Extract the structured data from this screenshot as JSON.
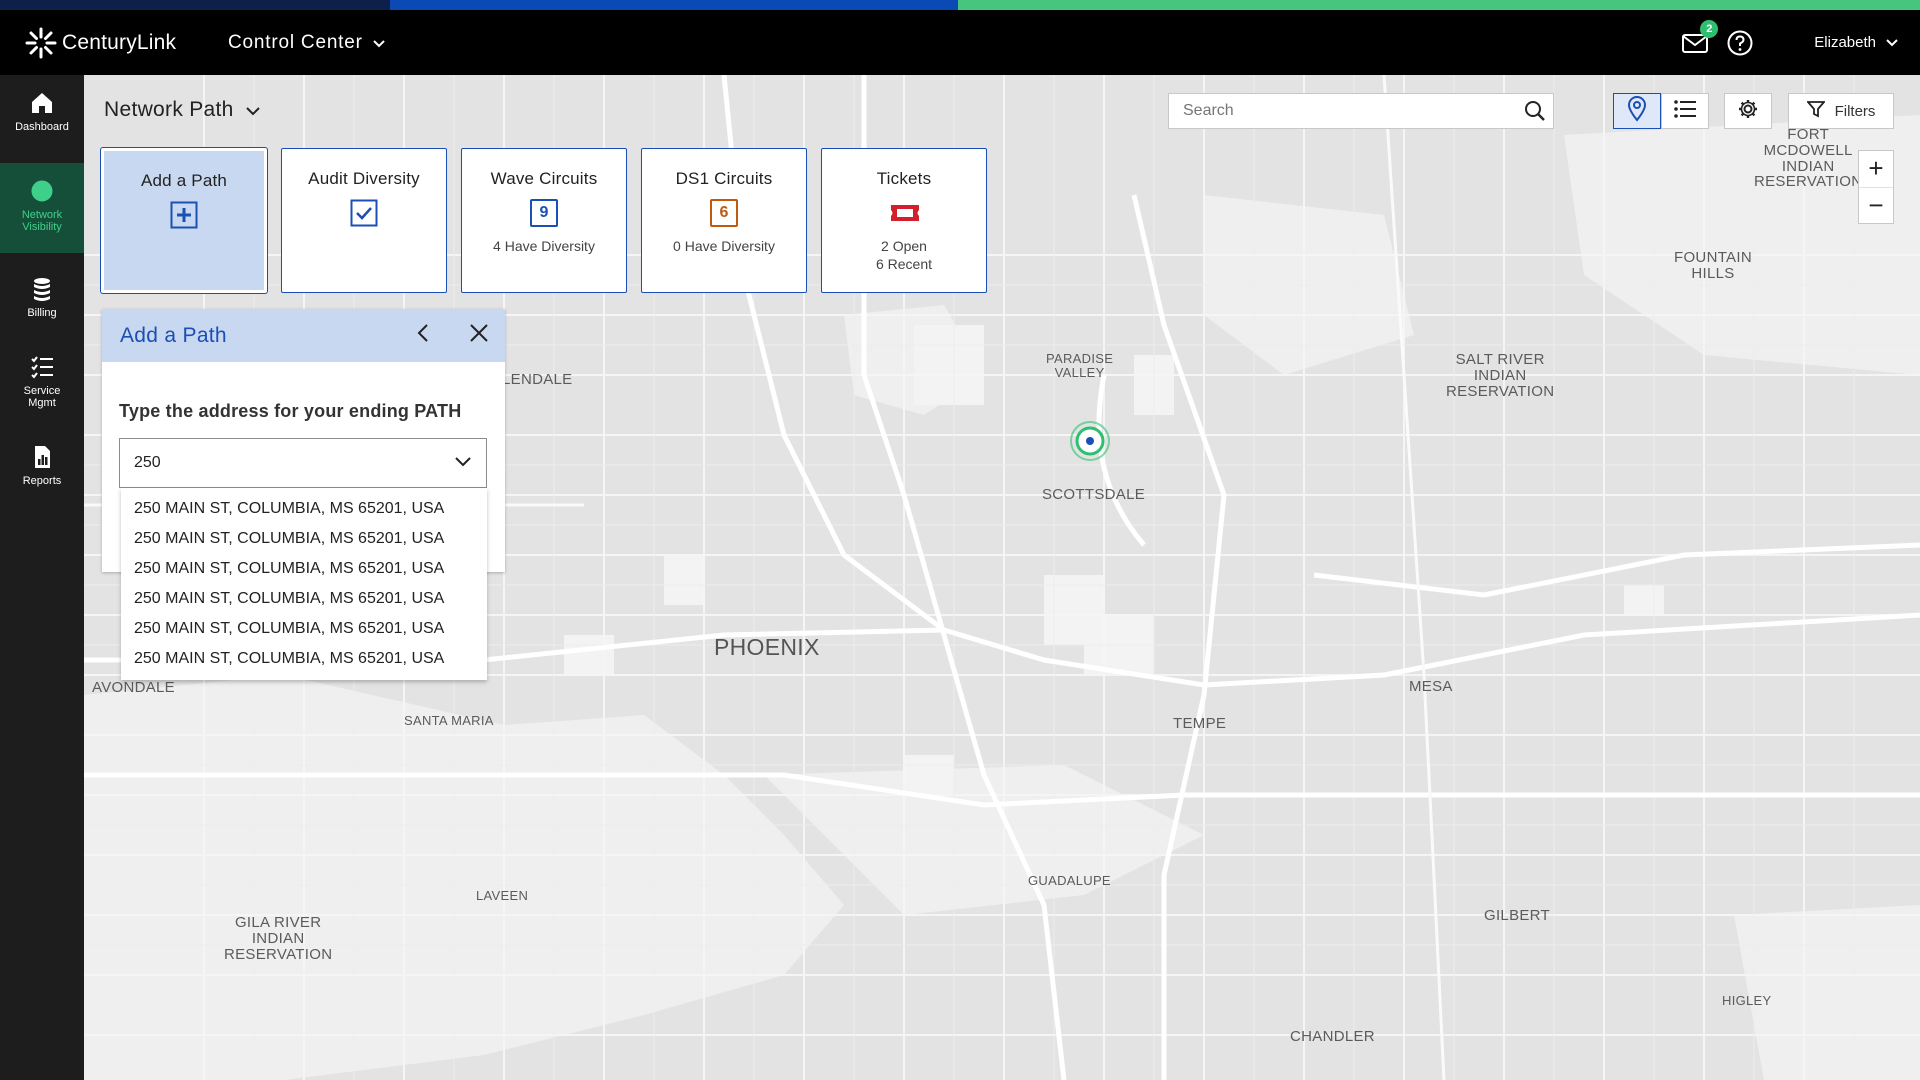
{
  "header": {
    "brand": "CenturyLink",
    "app_name": "Control Center",
    "mail_badge": "2",
    "user_name": "Elizabeth"
  },
  "sidenav": {
    "items": [
      {
        "label": "Dashboard",
        "icon": "home-icon"
      },
      {
        "label": "Network Visibility",
        "icon": "globe-icon"
      },
      {
        "label": "Billing",
        "icon": "coins-icon"
      },
      {
        "label": "Service Mgmt",
        "icon": "checklist-icon"
      },
      {
        "label": "Reports",
        "icon": "report-icon"
      }
    ],
    "active": "Network Visibility"
  },
  "page": {
    "title": "Network Path"
  },
  "cards": [
    {
      "title": "Add a Path",
      "icon": "plus-box-icon",
      "sub": ""
    },
    {
      "title": "Audit Diversity",
      "icon": "checkbox-icon",
      "sub": ""
    },
    {
      "title": "Wave Circuits",
      "count": "9",
      "sub": "4 Have Diversity",
      "color": "#1a4fb5"
    },
    {
      "title": "DS1 Circuits",
      "count": "6",
      "sub": "0 Have Diversity",
      "color": "#c05a10"
    },
    {
      "title": "Tickets",
      "icon": "ticket-icon",
      "sub1": "2 Open",
      "sub2": "6 Recent",
      "color": "#d1202c"
    }
  ],
  "toolbar": {
    "search_placeholder": "Search",
    "filters_label": "Filters",
    "zoom_in": "+",
    "zoom_out": "−"
  },
  "panel": {
    "title": "Add a Path",
    "prompt": "Type the address for your ending PATH",
    "input_value": "250",
    "options": [
      "250 MAIN ST, COLUMBIA, MS 65201, USA",
      "250 MAIN ST, COLUMBIA, MS 65201, USA",
      "250 MAIN ST, COLUMBIA, MS 65201, USA",
      "250 MAIN ST, COLUMBIA, MS 65201, USA",
      "250 MAIN ST, COLUMBIA, MS 65201, USA",
      "250 MAIN ST, COLUMBIA, MS 65201, USA"
    ]
  },
  "map": {
    "labels": {
      "fort": "FORT\nMCDOWELL\nINDIAN\nRESERVATION",
      "fountain": "FOUNTAIN\nHILLS",
      "paradise": "PARADISE\nVALLEY",
      "saltriver": "SALT RIVER\nINDIAN\nRESERVATION",
      "glendale": "LENDALE",
      "scottsdale": "SCOTTSDALE",
      "phoenix": "PHOENIX",
      "avondale": "AVONDALE",
      "mesa": "MESA",
      "santamaria": "SANTA MARIA",
      "tempe": "TEMPE",
      "guadalupe": "GUADALUPE",
      "laveen": "LAVEEN",
      "gila": "GILA RIVER\nINDIAN\nRESERVATION",
      "gilbert": "GILBERT",
      "higley": "HIGLEY",
      "chandler": "CHANDLER"
    },
    "marker_color": "#2fbf71"
  },
  "colors": {
    "accent": "#1a4fb5",
    "selected_bg": "#c9d8f1",
    "green": "#46c57f",
    "nav_bg": "#1d1d1d"
  }
}
